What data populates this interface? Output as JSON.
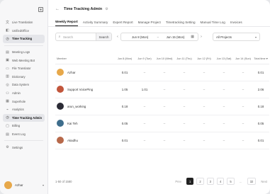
{
  "sidebar": {
    "top_items": [
      {
        "icon": "translate-icon",
        "glyph": "文",
        "label": "Live Translation"
      },
      {
        "icon": "unified-office-icon",
        "glyph": "◧",
        "label": "UnifiedOffice"
      },
      {
        "icon": "clock-icon",
        "glyph": "◷",
        "label": "Time Tracking"
      }
    ],
    "items": [
      {
        "icon": "meeting-logs-icon",
        "glyph": "▤",
        "label": "Meeting Logs"
      },
      {
        "icon": "web-meeting-bot-icon",
        "glyph": "▣",
        "label": "Web Meeting Bot"
      },
      {
        "icon": "file-translator-icon",
        "glyph": "▭",
        "label": "File Translator"
      },
      {
        "icon": "dictionary-icon",
        "glyph": "▥",
        "label": "Dictionary"
      },
      {
        "icon": "data-system-icon",
        "glyph": "◎",
        "label": "Data System"
      },
      {
        "icon": "admin-icon",
        "glyph": "⚇",
        "label": "Admin"
      },
      {
        "icon": "superhole-icon",
        "glyph": "▦",
        "label": "Superhole"
      },
      {
        "icon": "analytics-icon",
        "glyph": "⌁",
        "label": "Analytics"
      },
      {
        "icon": "time-tracking-admin-icon",
        "glyph": "◷",
        "label": "Time Tracking Admin"
      },
      {
        "icon": "billing-icon",
        "glyph": "▢",
        "label": "Billing"
      },
      {
        "icon": "event-log-icon",
        "glyph": "▤",
        "label": "Event Log"
      }
    ],
    "settings": {
      "icon": "gear-icon",
      "glyph": "⚙",
      "label": "Settings"
    },
    "user": {
      "name": "Azhar"
    }
  },
  "header": {
    "title": "Time Tracking Admin"
  },
  "tabs": [
    {
      "label": "Weekly Report",
      "active": true
    },
    {
      "label": "Activity Summary"
    },
    {
      "label": "Expert Report"
    },
    {
      "label": "Manage Project"
    },
    {
      "label": "Timetracking Setting"
    },
    {
      "label": "Manual Time Log"
    },
    {
      "label": "Invoices"
    }
  ],
  "filters": {
    "search_placeholder": "Search",
    "search_button": "Search",
    "date_from": "Jun 8 (Mon)",
    "date_to": "Jun 15 (Mon)",
    "project": "All Projects"
  },
  "table": {
    "columns": [
      "Member",
      "Jun 8 (Mon)",
      "Jun 9 (Tue)",
      "Jun 10 (Wed)",
      "Jun 11 (Thu)",
      "Jun 12 (Fri)",
      "Jun 13 (Sat)",
      "Jun 14 (Sun)",
      "Total time ▾"
    ],
    "rows": [
      {
        "name": "Azhar",
        "avatar_color": "#e7a84a",
        "cells": [
          "0.01",
          "–",
          "–",
          "–",
          "–",
          "–",
          "–",
          "0.01"
        ]
      },
      {
        "name": "Support VoicePing",
        "avatar_color": "#c2563c",
        "cells": [
          "1.05",
          "1.01",
          "–",
          "–",
          "–",
          "–",
          "–",
          "2.06"
        ]
      },
      {
        "name": "arun_working",
        "avatar_color": "#2b2b35",
        "cells": [
          "0.18",
          "–",
          "–",
          "–",
          "–",
          "–",
          "–",
          "0.18"
        ]
      },
      {
        "name": "Kai Teh",
        "avatar_color": "#3e6d8c",
        "cells": [
          "0.05",
          "–",
          "–",
          "–",
          "–",
          "–",
          "–",
          "0.05"
        ]
      },
      {
        "name": "Akadhu",
        "avatar_color": "#b7694a",
        "cells": [
          "0.01",
          "–",
          "–",
          "–",
          "–",
          "–",
          "–",
          "0.01"
        ]
      }
    ]
  },
  "footer": {
    "count": "1-50 of 1580",
    "prev": "Prev",
    "pages": [
      "1",
      "2",
      "3",
      "4",
      "5"
    ],
    "ellipsis": "...",
    "last_page": "32",
    "next": "Next"
  }
}
